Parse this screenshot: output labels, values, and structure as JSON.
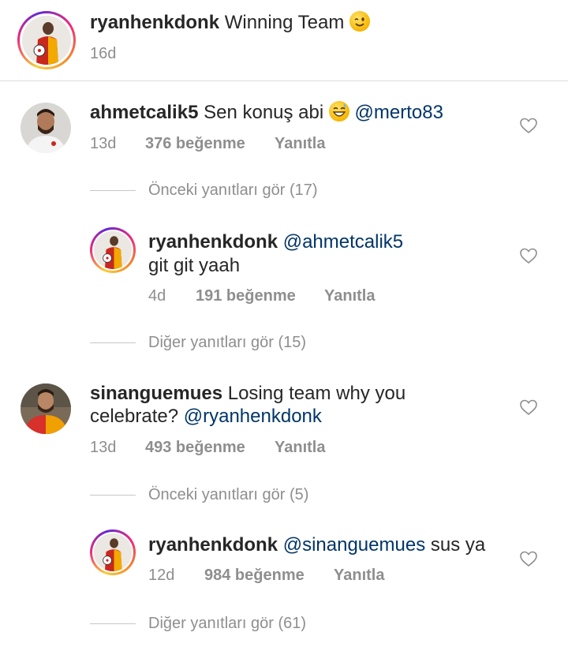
{
  "caption": {
    "username": "ryanhenkdonk",
    "text": "Winning Team",
    "emoji": "winking-face-emoji",
    "time": "16d"
  },
  "comments": [
    {
      "username": "ahmetcalik5",
      "text": "Sen konuş abi",
      "emoji": "grinning-sweat-emoji",
      "mention": "@merto83",
      "time": "13d",
      "likes": "376 beğenme",
      "reply": "Yanıtla",
      "view_previous": "Önceki yanıtları gör (17)",
      "reply_item": {
        "username": "ryanhenkdonk",
        "mention": "@ahmetcalik5",
        "text": "git git yaah",
        "time": "4d",
        "likes": "191 beğenme",
        "reply": "Yanıtla"
      },
      "view_more": "Diğer yanıtları gör (15)"
    },
    {
      "username": "sinanguemues",
      "text_line1": "Losing team why you",
      "text_line2": "celebrate?",
      "mention": "@ryanhenkdonk",
      "time": "13d",
      "likes": "493 beğenme",
      "reply": "Yanıtla",
      "view_previous": "Önceki yanıtları gör (5)",
      "reply_item": {
        "username": "ryanhenkdonk",
        "mention": "@sinanguemues",
        "text": "sus ya",
        "time": "12d",
        "likes": "984 beğenme",
        "reply": "Yanıtla"
      },
      "view_more": "Diğer yanıtları gör (61)"
    }
  ],
  "colors": {
    "text": "#262626",
    "secondary": "#8e8e8e",
    "mention": "#003569",
    "divider": "#dbdbdb"
  }
}
